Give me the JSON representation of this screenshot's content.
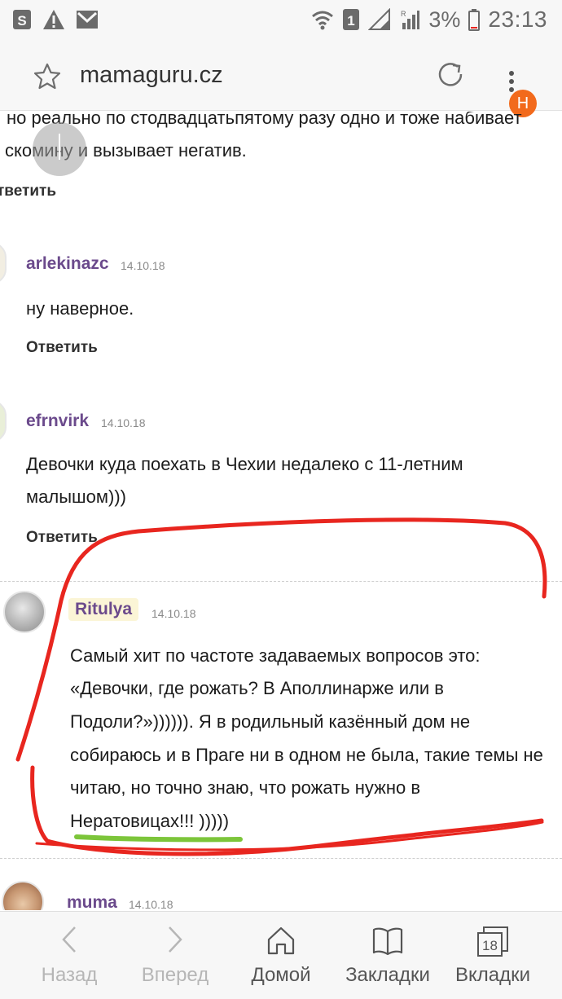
{
  "status_bar": {
    "sim_icon": "sim-s-icon",
    "warning_icon": "warning-icon",
    "mail_icon": "mail-icon",
    "wifi_icon": "wifi-icon",
    "sim_slot": "1",
    "signal_icon": "signal-icon",
    "battery_percent": "3%",
    "time": "23:13"
  },
  "browser": {
    "url": "mamaguru.cz",
    "bookmark_icon": "star-icon",
    "reload_icon": "reload-icon",
    "menu_icon": "more-vert-icon",
    "profile_badge": "Н"
  },
  "comments": {
    "partial_text_line1": "но реально по стодвадцатьпятому разу одно и тоже набивает",
    "partial_text_line2": "скомину и вызывает негатив.",
    "partial_reply": "тветить",
    "items": [
      {
        "user": "arlekinazc",
        "date": "14.10.18",
        "text": [
          "ну наверное."
        ],
        "reply": "Ответить"
      },
      {
        "user": "efrnvirk",
        "date": "14.10.18",
        "text": [
          "Девочки куда поехать в Чехии недалеко с 11-летним",
          "малышом)))"
        ],
        "reply": "Ответить"
      },
      {
        "user": "Ritulya",
        "date": "14.10.18",
        "text": [
          "Самый хит по частоте задаваемых вопросов это:",
          "«Девочки, где рожать? В Аполлинарже или в",
          "Подоли?»)))))). Я в родильный казённый дом не",
          "собираюсь и в Праге ни в одном не была, такие темы не",
          "читаю, но точно знаю, что рожать нужно в",
          "Нератовицах!!! )))))"
        ]
      },
      {
        "user": "muma",
        "date": "14.10.18"
      }
    ]
  },
  "annotation": {
    "circle_color": "#e8261f",
    "underline_color": "#7cc53a"
  },
  "bottom_nav": {
    "back": "Назад",
    "forward": "Вперед",
    "home": "Домой",
    "bookmarks": "Закладки",
    "tabs": "Вкладки",
    "tabs_count": "18"
  }
}
